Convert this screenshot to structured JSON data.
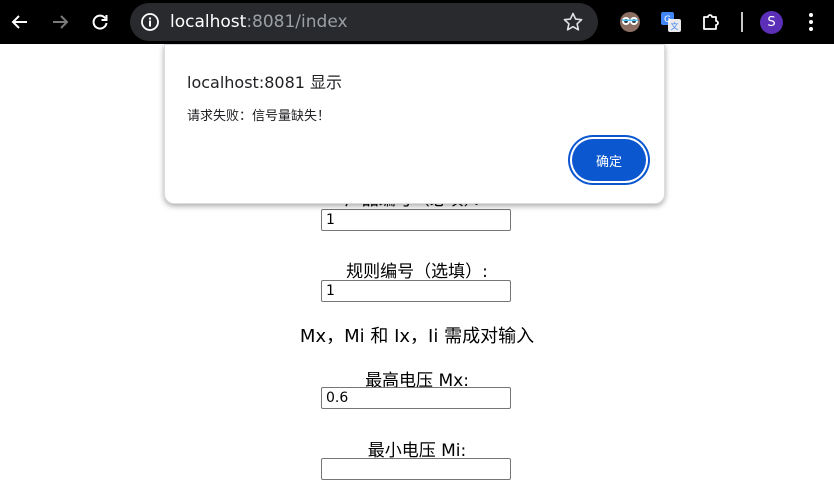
{
  "browser": {
    "url_host": "localhost",
    "url_rest": ":8081/index",
    "profile_initial": "S"
  },
  "form": {
    "partial_label": "  产品编号（必填）：",
    "field1_value": "1",
    "rule_label": "规则编号（选填）:",
    "rule_value": "1",
    "note": "Mx，Mi 和 Ix，Ii 需成对输入",
    "max_voltage_label": "最高电压 Mx:",
    "max_voltage_value": "0.6",
    "min_voltage_label": "最小电压 Mi:",
    "min_voltage_value": ""
  },
  "dialog": {
    "title": "localhost:8081 显示",
    "message": "请求失败：信号量缺失！",
    "ok_label": "确定"
  },
  "colors": {
    "accent": "#0b57d0",
    "toolbar": "#000000",
    "omnibox": "#282a2d"
  }
}
